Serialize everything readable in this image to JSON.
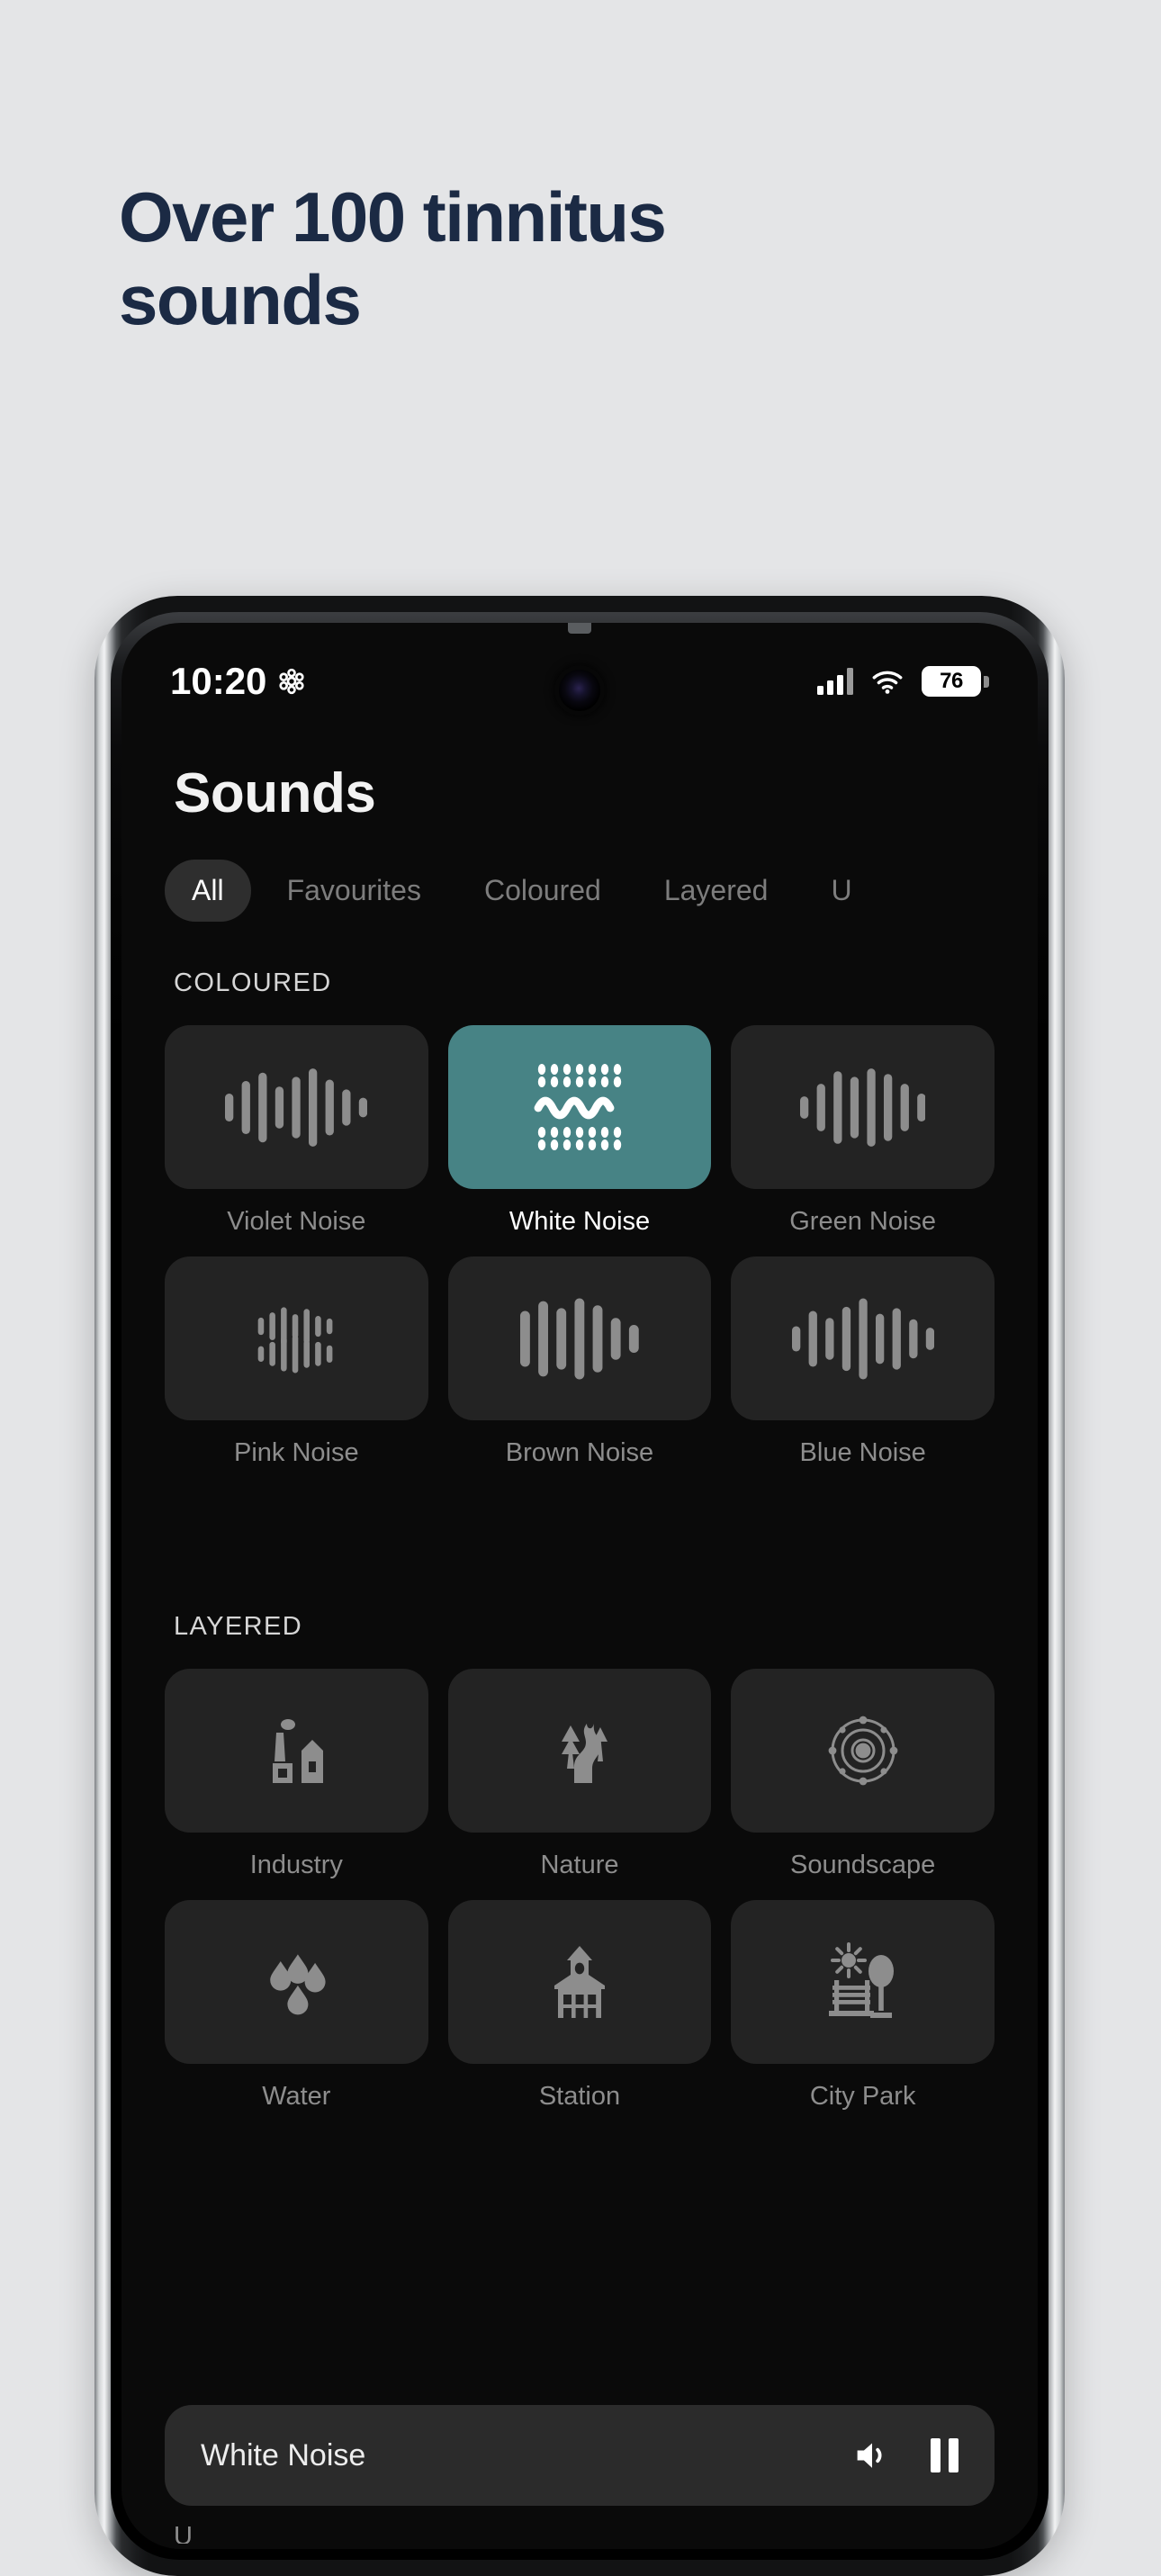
{
  "marketing": {
    "headline": "Over 100 tinnitus\nsounds",
    "headline_color": "#1b2a44",
    "background_color": "#e4e5e7"
  },
  "status_bar": {
    "time": "10:20",
    "flower_icon": "flower-icon",
    "signal_icon": "cellular-signal-icon",
    "wifi_icon": "wifi-icon",
    "battery_level": "76",
    "camera": "front-camera"
  },
  "app": {
    "title": "Sounds",
    "accent_color": "#478385",
    "card_color": "#232323",
    "background_color": "#0a0a0a",
    "tabs": [
      {
        "label": "All",
        "active": true
      },
      {
        "label": "Favourites",
        "active": false
      },
      {
        "label": "Coloured",
        "active": false
      },
      {
        "label": "Layered",
        "active": false
      },
      {
        "label": "U",
        "active": false
      }
    ],
    "sections": [
      {
        "label": "COLOURED",
        "tiles": [
          {
            "label": "Violet Noise",
            "icon": "waveform-violet-icon",
            "selected": false
          },
          {
            "label": "White Noise",
            "icon": "waveform-white-noise-icon",
            "selected": true
          },
          {
            "label": "Green Noise",
            "icon": "waveform-green-icon",
            "selected": false
          },
          {
            "label": "Pink Noise",
            "icon": "waveform-pink-icon",
            "selected": false
          },
          {
            "label": "Brown Noise",
            "icon": "waveform-brown-icon",
            "selected": false
          },
          {
            "label": "Blue Noise",
            "icon": "waveform-blue-icon",
            "selected": false
          }
        ]
      },
      {
        "label": "LAYERED",
        "tiles": [
          {
            "label": "Industry",
            "icon": "factory-icon",
            "selected": false
          },
          {
            "label": "Nature",
            "icon": "river-trees-icon",
            "selected": false
          },
          {
            "label": "Soundscape",
            "icon": "orbit-icon",
            "selected": false
          },
          {
            "label": "Water",
            "icon": "water-droplets-icon",
            "selected": false
          },
          {
            "label": "Station",
            "icon": "station-building-icon",
            "selected": false
          },
          {
            "label": "City Park",
            "icon": "park-bench-tree-icon",
            "selected": false
          }
        ]
      }
    ],
    "player": {
      "title": "White Noise",
      "volume_icon": "volume-icon",
      "pause_icon": "pause-icon"
    },
    "bottom_peek": "U"
  }
}
